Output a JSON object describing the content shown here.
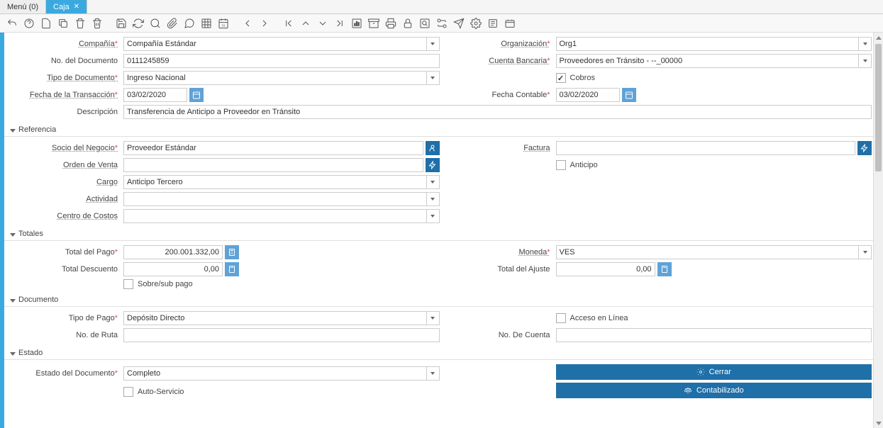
{
  "tabs": {
    "menu": "Menú (0)",
    "active": "Caja"
  },
  "sections": {
    "referencia": "Referencia",
    "totales": "Totales",
    "documento": "Documento",
    "estado": "Estado"
  },
  "labels": {
    "compania": "Compañía",
    "no_documento": "No. del Documento",
    "tipo_documento": "Tipo de Documento",
    "fecha_transaccion": "Fecha de la Transacción",
    "descripcion": "Descripción",
    "organizacion": "Organización",
    "cuenta_bancaria": "Cuenta Bancaria",
    "cobros": "Cobros",
    "fecha_contable": "Fecha Contable",
    "socio_negocio": "Socio del Negocio",
    "orden_venta": "Orden de Venta",
    "cargo": "Cargo",
    "actividad": "Actividad",
    "centro_costos": "Centro de Costos",
    "factura": "Factura",
    "anticipo": "Anticipo",
    "total_pago": "Total del Pago",
    "total_descuento": "Total Descuento",
    "sobre_sub": "Sobre/sub pago",
    "moneda": "Moneda",
    "total_ajuste": "Total del Ajuste",
    "tipo_pago": "Tipo de Pago",
    "no_ruta": "No. de Ruta",
    "acceso_linea": "Acceso en Línea",
    "no_cuenta": "No. De Cuenta",
    "estado_doc": "Estado del Documento",
    "auto_servicio": "Auto-Servicio"
  },
  "values": {
    "compania": "Compañía Estándar",
    "no_documento": "0111245859",
    "tipo_documento": "Ingreso Nacional",
    "fecha_transaccion": "03/02/2020",
    "descripcion": "Transferencia de Anticipo a Proveedor en Tránsito",
    "organizacion": "Org1",
    "cuenta_bancaria": "Proveedores en Tránsito - --_00000",
    "fecha_contable": "03/02/2020",
    "socio_negocio": "Proveedor Estándar",
    "cargo": "Anticipo Tercero",
    "total_pago": "200.001.332,00",
    "total_descuento": "0,00",
    "moneda": "VES",
    "total_ajuste": "0,00",
    "tipo_pago": "Depósito Directo",
    "estado_doc": "Completo"
  },
  "buttons": {
    "cerrar": "Cerrar",
    "contabilizado": "Contabilizado"
  }
}
